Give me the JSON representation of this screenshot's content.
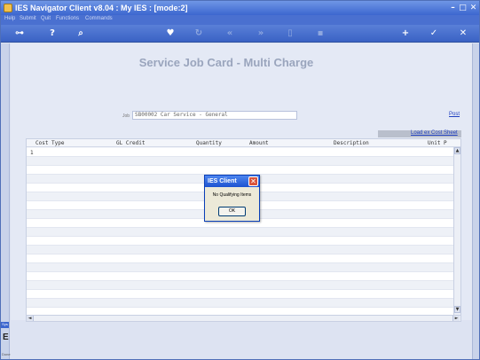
{
  "window": {
    "title": "IES Navigator Client v8.04 : My IES :      [mode:2]",
    "minimize_glyph": "–",
    "maximize_glyph": "□",
    "close_glyph": "✕"
  },
  "menu": [
    "Help",
    "Submit",
    "Quit",
    "Functions",
    "Commands"
  ],
  "toolbar": {
    "icons": [
      "back-key-icon",
      "help-icon",
      "search-icon",
      "favorite-heart-icon",
      "refresh-icon",
      "rewind-icon",
      "fast-forward-icon",
      "blank-doc-icon",
      "window-icon",
      "add-icon",
      "confirm-check-icon",
      "cancel-x-icon"
    ],
    "glyphs": {
      "back": "⊶",
      "help": "?",
      "search": "⌕",
      "heart": "♥",
      "refresh": "↻",
      "rewind": "«",
      "forward": "»",
      "doc": "▯",
      "window": "▪",
      "add": "+",
      "check": "✓",
      "cancel": "✕"
    }
  },
  "page": {
    "title": "Service Job Card - Multi Charge",
    "job_label": "Job",
    "job_value": "SB00002 Car Service - General",
    "post_link": "Post",
    "load_link": "Load ex Cost Sheet"
  },
  "grid": {
    "columns": [
      "Cost Type",
      "GL Credit",
      "Quantity",
      "Amount",
      "Description",
      "Unit P"
    ],
    "first_row_number": "1",
    "scroll_up": "▲",
    "scroll_down": "▼",
    "scroll_left": "◄",
    "scroll_right": "►"
  },
  "dialog": {
    "title": "IES Client",
    "message": "No Qualifying Items",
    "ok_label": "OK",
    "close_glyph": "✕"
  },
  "sidebar": {
    "badge": "Sys",
    "letter": "E",
    "footer": "Done"
  },
  "colors": {
    "titlebar": "#3c66cf",
    "dialog_titlebar": "#1c52d0",
    "link": "#1f3fbf",
    "background": "#e4e9f5"
  }
}
